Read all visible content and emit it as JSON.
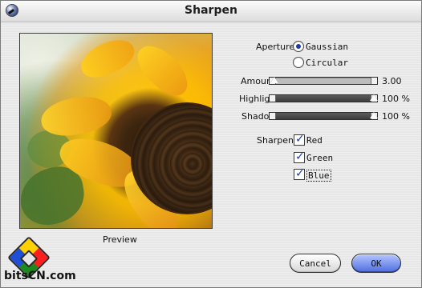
{
  "window": {
    "title": "Sharpen"
  },
  "preview": {
    "label": "Preview"
  },
  "aperture": {
    "label": "Aperture:",
    "options": [
      {
        "label": "Gaussian",
        "selected": true
      },
      {
        "label": "Circular",
        "selected": false
      }
    ]
  },
  "sliders": [
    {
      "label": "Amount",
      "value_text": "3.00",
      "level": 0.03
    },
    {
      "label": "Highlight",
      "value_text": "100 %",
      "level": 1.0
    },
    {
      "label": "Shadow",
      "value_text": "100 %",
      "level": 1.0
    }
  ],
  "sharpen": {
    "label": "Sharpen:",
    "channels": [
      {
        "label": "Red",
        "checked": true
      },
      {
        "label": "Green",
        "checked": true
      },
      {
        "label": "Blue",
        "checked": true
      }
    ]
  },
  "buttons": {
    "cancel": "Cancel",
    "ok": "OK"
  },
  "watermark": {
    "text": "bitsCN.com"
  },
  "icons": {
    "app": "sharpen-app-icon",
    "radio": "radio-icon",
    "checkbox": "checkbox-icon",
    "logo": "bitscn-logo"
  }
}
